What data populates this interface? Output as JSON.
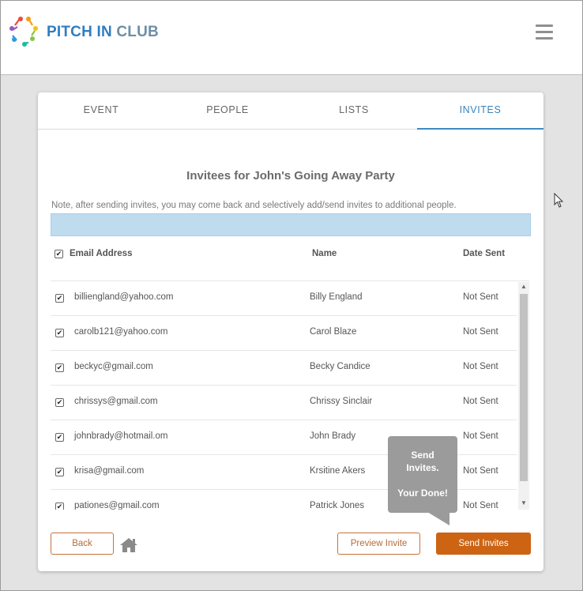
{
  "header": {
    "brand_part1": "PITCH IN",
    "brand_part2": "CLUB",
    "logo_icon": "people-circle-logo",
    "menu_icon": "hamburger-icon"
  },
  "tabs": [
    {
      "label": "EVENT",
      "active": false
    },
    {
      "label": "PEOPLE",
      "active": false
    },
    {
      "label": "LISTS",
      "active": false
    },
    {
      "label": "INVITES",
      "active": true
    }
  ],
  "main": {
    "title": "Invitees for John's Going Away Party",
    "note": "Note, after sending invites, you may come back and selectively add/send invites to additional people.",
    "columns": {
      "email": "Email Address",
      "name": "Name",
      "date_sent": "Date Sent"
    },
    "select_all_checked": true,
    "invitees": [
      {
        "email": "billiengland@yahoo.com",
        "name": "Billy England",
        "date_sent": "Not Sent",
        "checked": true
      },
      {
        "email": "carolb121@yahoo.com",
        "name": "Carol Blaze",
        "date_sent": "Not Sent",
        "checked": true
      },
      {
        "email": "beckyc@gmail.com",
        "name": "Becky Candice",
        "date_sent": "Not Sent",
        "checked": true
      },
      {
        "email": "chrissys@gmail.com",
        "name": "Chrissy Sinclair",
        "date_sent": "Not Sent",
        "checked": true
      },
      {
        "email": "johnbrady@hotmail.om",
        "name": "John Brady",
        "date_sent": "Not Sent",
        "checked": true
      },
      {
        "email": "krisa@gmail.com",
        "name": "Krsitine Akers",
        "date_sent": "Not Sent",
        "checked": true
      },
      {
        "email": "pationes@gmail.com",
        "name": "Patrick Jones",
        "date_sent": "Not Sent",
        "checked": true
      }
    ]
  },
  "footer": {
    "back_label": "Back",
    "home_icon": "home-icon",
    "preview_label": "Preview Invite",
    "send_label": "Send Invites"
  },
  "tooltip": {
    "line1": "Send",
    "line2": "Invites.",
    "line3": "Your Done!"
  },
  "colors": {
    "brand_blue": "#2f7ec0",
    "accent_orange": "#cc6414",
    "tab_active": "#3f8ac2",
    "highlight_bar": "#bfdcef"
  }
}
